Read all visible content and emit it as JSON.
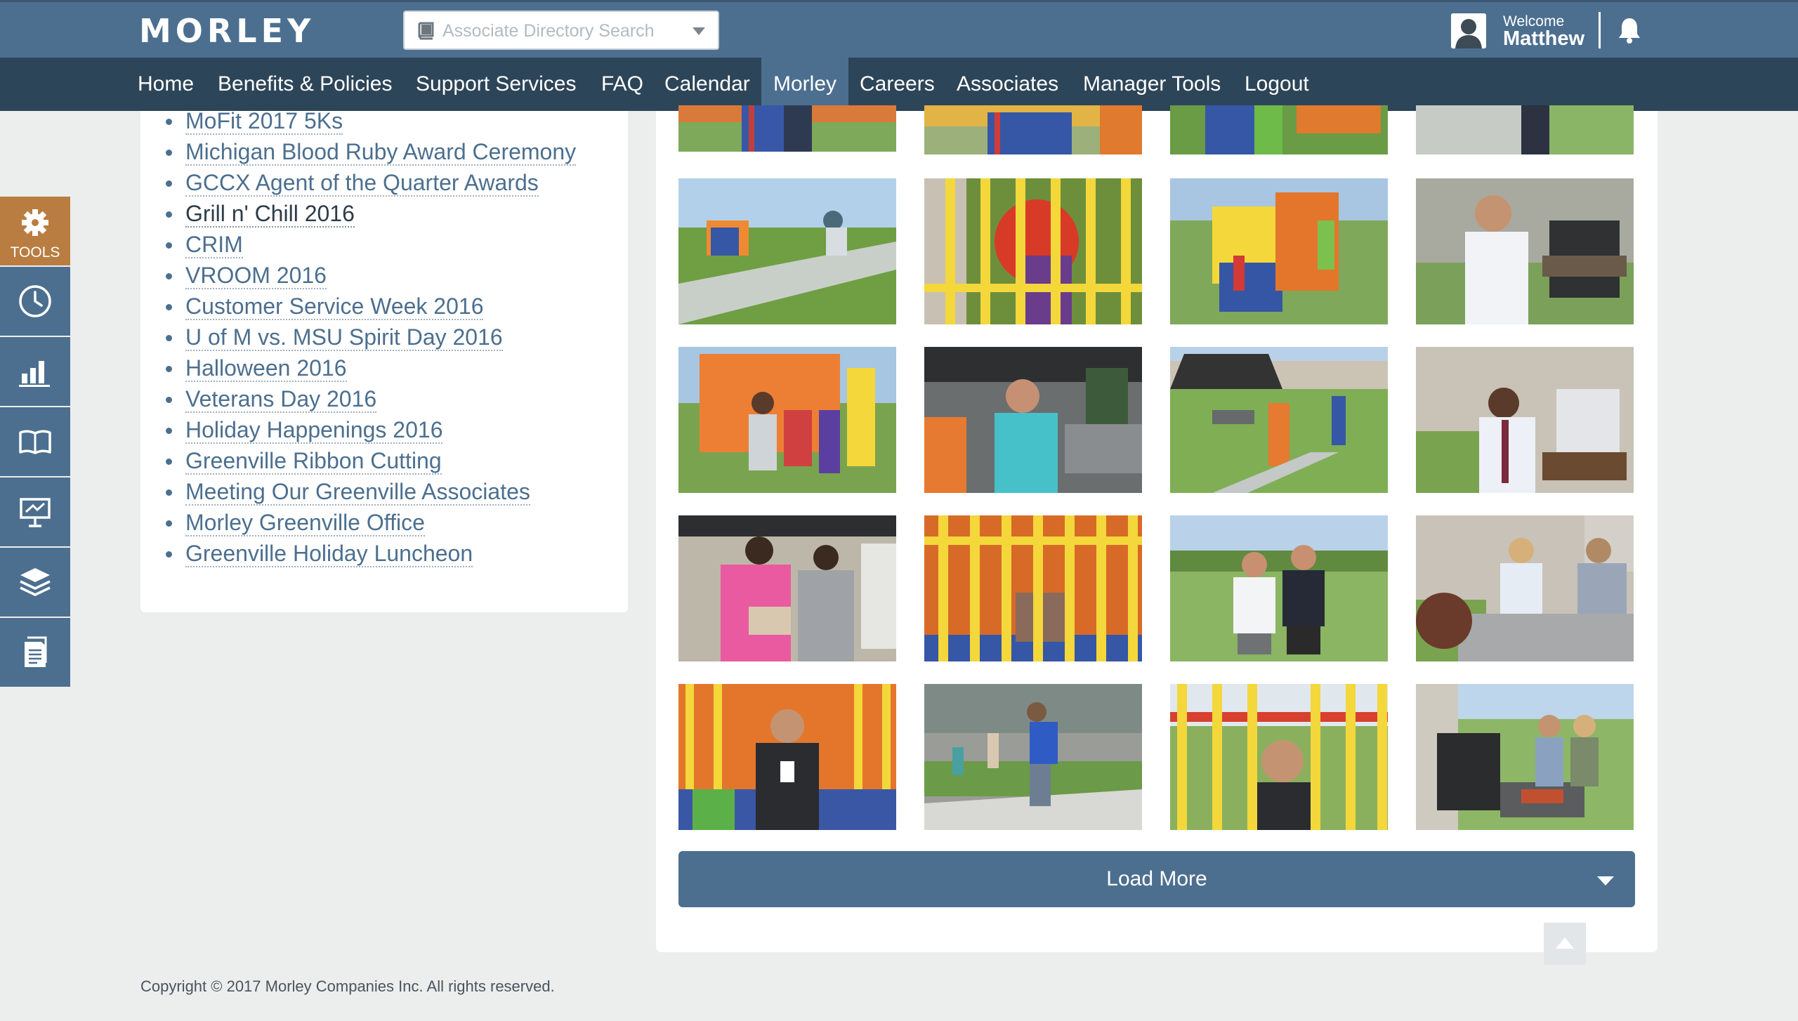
{
  "header": {
    "logo_text": "MORLEY",
    "search_placeholder": "Associate Directory Search",
    "welcome_label": "Welcome",
    "user_name": "Matthew"
  },
  "nav": {
    "items": [
      {
        "label": "Home"
      },
      {
        "label": "Benefits & Policies"
      },
      {
        "label": "Support Services"
      },
      {
        "label": "FAQ"
      },
      {
        "label": "Calendar"
      },
      {
        "label": "Morley",
        "active": true
      },
      {
        "label": "Careers"
      },
      {
        "label": "Associates"
      },
      {
        "label": "Manager Tools"
      },
      {
        "label": "Logout"
      }
    ]
  },
  "tools": {
    "label": "TOOLS",
    "icons": [
      "gear-icon",
      "clock-icon",
      "bar-chart-icon",
      "open-book-icon",
      "presentation-icon",
      "layers-icon",
      "document-icon"
    ]
  },
  "event_list": {
    "items": [
      {
        "label": "MoFit 2017 5Ks"
      },
      {
        "label": "Michigan Blood Ruby Award Ceremony"
      },
      {
        "label": "GCCX Agent of the Quarter Awards"
      },
      {
        "label": "Grill n' Chill 2016",
        "current": true
      },
      {
        "label": "CRIM"
      },
      {
        "label": "VROOM 2016"
      },
      {
        "label": "Customer Service Week 2016"
      },
      {
        "label": "U of M vs. MSU Spirit Day 2016"
      },
      {
        "label": "Halloween 2016"
      },
      {
        "label": "Veterans Day 2016"
      },
      {
        "label": "Holiday Happenings 2016"
      },
      {
        "label": "Greenville Ribbon Cutting"
      },
      {
        "label": "Meeting Our Greenville Associates"
      },
      {
        "label": "Morley Greenville Office"
      },
      {
        "label": "Greenville Holiday Luncheon"
      }
    ]
  },
  "gallery": {
    "load_more_label": "Load More"
  },
  "colors": {
    "header_blue": "#4c6f8f",
    "nav_dark": "#2d4558",
    "tools_orange": "#b97d41",
    "page_bg": "#eceeee"
  },
  "footer": {
    "copyright": "Copyright © 2017 Morley Companies Inc. All rights reserved."
  }
}
